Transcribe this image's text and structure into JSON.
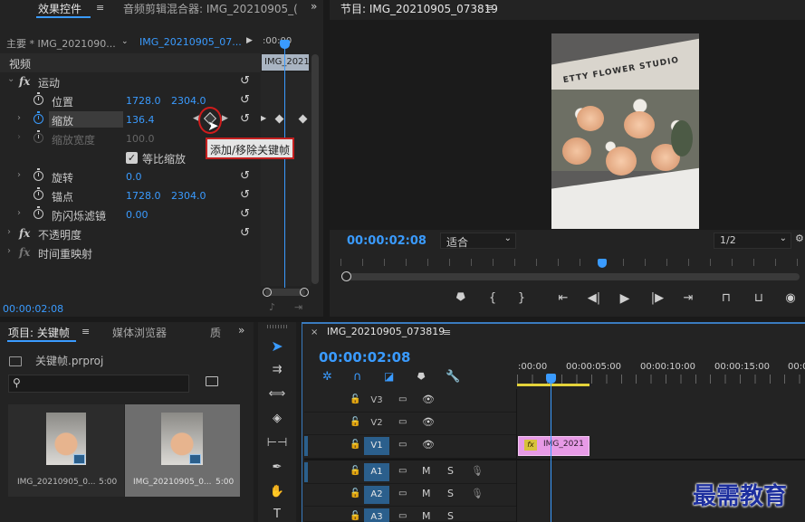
{
  "effect_controls": {
    "tab_active": "效果控件",
    "tab_other": "音频剪辑混合器: IMG_20210905_(",
    "master_label": "主要 * IMG_2021090...",
    "sequence_clip": "IMG_20210905_07...",
    "mini_time": ":00:00",
    "mini_clip": "IMG_2021",
    "section_video": "视频",
    "motion": "运动",
    "position_label": "位置",
    "position_x": "1728.0",
    "position_y": "2304.0",
    "scale_label": "缩放",
    "scale_value": "136.4",
    "scale_width_label": "缩放宽度",
    "scale_width_value": "100.0",
    "uniform_scale_label": "等比缩放",
    "rotation_label": "旋转",
    "rotation_value": "0.0",
    "anchor_label": "锚点",
    "anchor_x": "1728.0",
    "anchor_y": "2304.0",
    "antiflicker_label": "防闪烁滤镜",
    "antiflicker_value": "0.00",
    "opacity_label": "不透明度",
    "time_remap_label": "时间重映射",
    "tooltip": "添加/移除关键帧",
    "timecode": "00:00:02:08"
  },
  "program": {
    "title": "节目: IMG_20210905_073819",
    "image_text": "ETTY FLOWER STUDIO",
    "timecode": "00:00:02:08",
    "fit": "适合",
    "resolution": "1/2"
  },
  "project": {
    "tab_active": "项目: 关键帧",
    "tab_media": "媒体浏览器",
    "tab_more": "质",
    "file": "关键帧.prproj",
    "items": [
      {
        "name": "IMG_20210905_0...",
        "duration": "5:00"
      },
      {
        "name": "IMG_20210905_0...",
        "duration": "5:00"
      }
    ]
  },
  "timeline": {
    "tab": "IMG_20210905_073819",
    "timecode": "00:00:02:08",
    "ruler": [
      ":00:00",
      "00:00:05:00",
      "00:00:10:00",
      "00:00:15:00",
      "00:0"
    ],
    "clip_label": "IMG_2021",
    "clip_fx": "fx",
    "tracks": [
      {
        "name": "V3",
        "type": "video",
        "selected": false
      },
      {
        "name": "V2",
        "type": "video",
        "selected": false
      },
      {
        "name": "V1",
        "type": "video",
        "selected": false
      },
      {
        "name": "A1",
        "type": "audio",
        "selected": true
      },
      {
        "name": "A2",
        "type": "audio",
        "selected": true
      },
      {
        "name": "A3",
        "type": "audio",
        "selected": true
      }
    ],
    "mute_label": "M",
    "solo_label": "S"
  },
  "watermark": "最需教育",
  "colors": {
    "accent": "#3a9bff",
    "clip": "#e79ae6",
    "highlight_circle": "#d01c1c"
  }
}
